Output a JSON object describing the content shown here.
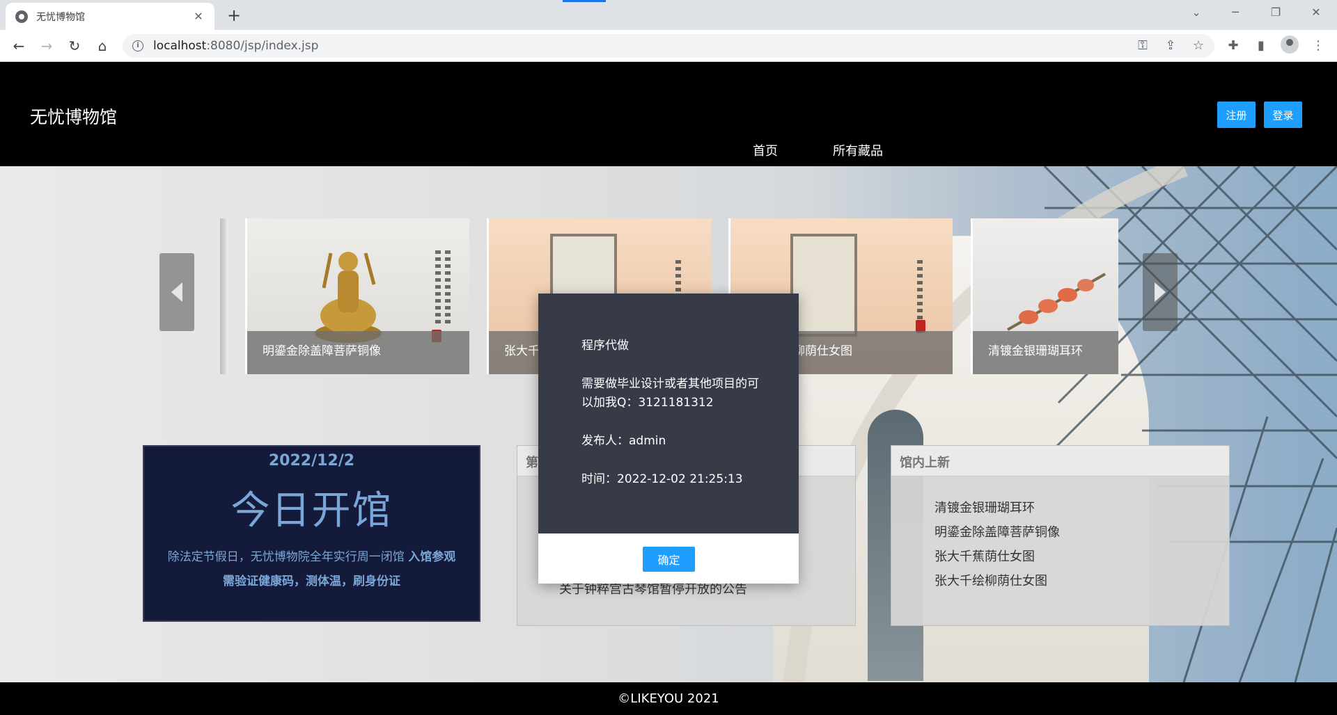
{
  "browser": {
    "tab_title": "无忧博物馆",
    "url_host": "localhost",
    "url_rest": ":8080/jsp/index.jsp"
  },
  "header": {
    "logo": "无忧博物馆",
    "register_label": "注册",
    "login_label": "登录",
    "nav": [
      {
        "label": "首页"
      },
      {
        "label": "所有藏品"
      }
    ]
  },
  "carousel": {
    "items": [
      {
        "caption": "明鎏金除盖障菩萨铜像",
        "bg": "#e9e7e4"
      },
      {
        "caption": "张大千蕉荫仕女图",
        "bg": "#f1d3b8"
      },
      {
        "caption": "张大千绘柳荫仕女图",
        "bg": "#f1d3b8"
      },
      {
        "caption": "清镀金银珊瑚耳环",
        "bg": "#ecebea"
      }
    ]
  },
  "opening": {
    "date": "2022/12/2",
    "status": "今日开馆",
    "desc_plain": "除法定节假日，无忧博物院全年实行周一闭馆 ",
    "desc_bold": "入馆参观需验证健康码，测体温，刷身份证"
  },
  "notice_panel": {
    "title_partial": "第",
    "item": "关于钟粹宫古琴馆暂停开放的公告"
  },
  "new_panel": {
    "title": "馆内上新",
    "items": [
      "清镀金银珊瑚耳环",
      "明鎏金除盖障菩萨铜像",
      "张大千蕉荫仕女图",
      "张大千绘柳荫仕女图"
    ]
  },
  "modal": {
    "title": "程序代做",
    "message": "需要做毕业设计或者其他项目的可以加我Q：3121181312",
    "publisher": "发布人：admin",
    "time": "时间：2022-12-02 21:25:13",
    "ok_label": "确定"
  },
  "footer": {
    "copyright": "©LIKEYOU 2021"
  }
}
